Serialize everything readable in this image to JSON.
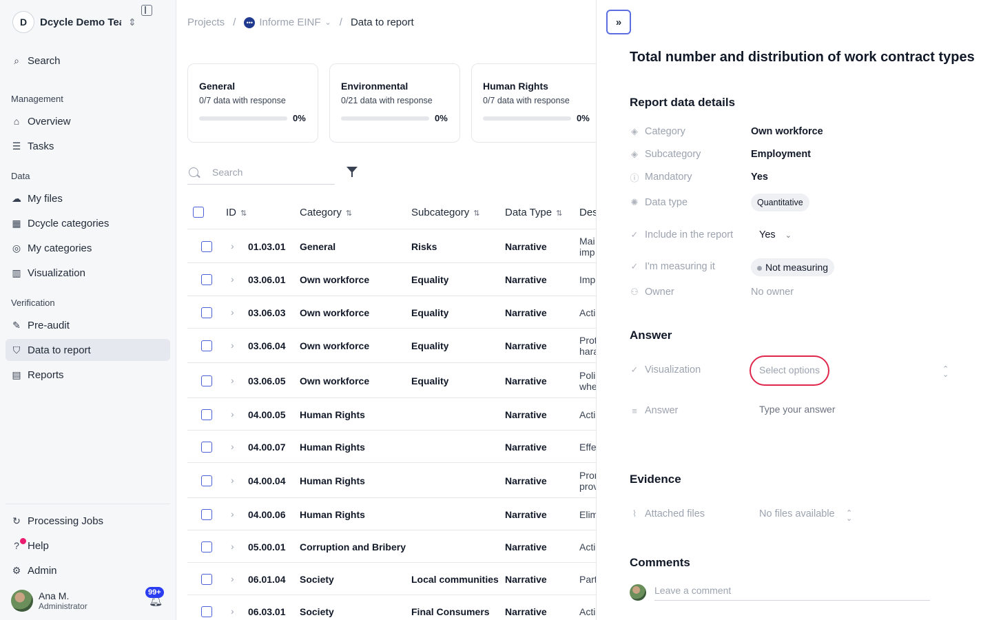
{
  "sidebar": {
    "workspace_initial": "D",
    "workspace_name": "Dcycle Demo Team",
    "search_label": "Search",
    "sections": {
      "management": "Management",
      "data": "Data",
      "verification": "Verification"
    },
    "items": {
      "overview": "Overview",
      "tasks": "Tasks",
      "my_files": "My files",
      "dcycle_categories": "Dcycle categories",
      "my_categories": "My categories",
      "visualization": "Visualization",
      "pre_audit": "Pre-audit",
      "data_to_report": "Data to report",
      "reports": "Reports",
      "processing_jobs": "Processing Jobs",
      "help": "Help",
      "admin": "Admin"
    },
    "user": {
      "name": "Ana M.",
      "role": "Administrator",
      "notifications": "99+"
    }
  },
  "breadcrumb": {
    "projects": "Projects",
    "project": "Informe EINF",
    "current": "Data to report"
  },
  "cards": [
    {
      "title": "General",
      "subtitle": "0/7 data with response",
      "percent": "0%",
      "progress": 0
    },
    {
      "title": "Environmental",
      "subtitle": "0/21 data with response",
      "percent": "0%",
      "progress": 0
    },
    {
      "title": "Human Rights",
      "subtitle": "0/7 data with response",
      "percent": "0%",
      "progress": 0
    }
  ],
  "search": {
    "placeholder": "Search"
  },
  "table": {
    "headers": {
      "id": "ID",
      "category": "Category",
      "subcategory": "Subcategory",
      "data_type": "Data Type",
      "description": "Des"
    },
    "rows": [
      {
        "id": "01.03.01",
        "category": "General",
        "subcategory": "Risks",
        "type": "Narrative",
        "desc1": "Mai",
        "desc2": "imp"
      },
      {
        "id": "03.06.01",
        "category": "Own workforce",
        "subcategory": "Equality",
        "type": "Narrative",
        "desc1": "Imp",
        "desc2": ""
      },
      {
        "id": "03.06.03",
        "category": "Own workforce",
        "subcategory": "Equality",
        "type": "Narrative",
        "desc1": "Acti",
        "desc2": ""
      },
      {
        "id": "03.06.04",
        "category": "Own workforce",
        "subcategory": "Equality",
        "type": "Narrative",
        "desc1": "Prot",
        "desc2": "hara"
      },
      {
        "id": "03.06.05",
        "category": "Own workforce",
        "subcategory": "Equality",
        "type": "Narrative",
        "desc1": "Poli",
        "desc2": "whe"
      },
      {
        "id": "04.00.05",
        "category": "Human Rights",
        "subcategory": "",
        "type": "Narrative",
        "desc1": "Acti",
        "desc2": ""
      },
      {
        "id": "04.00.07",
        "category": "Human Rights",
        "subcategory": "",
        "type": "Narrative",
        "desc1": "Effe",
        "desc2": ""
      },
      {
        "id": "04.00.04",
        "category": "Human Rights",
        "subcategory": "",
        "type": "Narrative",
        "desc1": "Pron",
        "desc2": "prov"
      },
      {
        "id": "04.00.06",
        "category": "Human Rights",
        "subcategory": "",
        "type": "Narrative",
        "desc1": "Elim",
        "desc2": ""
      },
      {
        "id": "05.00.01",
        "category": "Corruption and Bribery",
        "subcategory": "",
        "type": "Narrative",
        "desc1": "Acti",
        "desc2": ""
      },
      {
        "id": "06.01.04",
        "category": "Society",
        "subcategory": "Local communities",
        "type": "Narrative",
        "desc1": "Part",
        "desc2": ""
      },
      {
        "id": "06.03.01",
        "category": "Society",
        "subcategory": "Final Consumers",
        "type": "Narrative",
        "desc1": "Acti",
        "desc2": ""
      }
    ]
  },
  "panel": {
    "title": "Total number and distribution of work contract types",
    "details_heading": "Report data details",
    "labels": {
      "category": "Category",
      "subcategory": "Subcategory",
      "mandatory": "Mandatory",
      "data_type": "Data type",
      "include": "Include in the report",
      "measuring": "I'm measuring it",
      "owner": "Owner",
      "visualization": "Visualization",
      "answer": "Answer",
      "attached": "Attached files"
    },
    "values": {
      "category": "Own workforce",
      "subcategory": "Employment",
      "mandatory": "Yes",
      "data_type": "Quantitative",
      "include": "Yes",
      "measuring": "Not measuring",
      "owner": "No owner",
      "visualization_placeholder": "Select options",
      "answer_placeholder": "Type your answer",
      "attached": "No files available"
    },
    "answer_heading": "Answer",
    "evidence_heading": "Evidence",
    "comments_heading": "Comments",
    "comment_placeholder": "Leave a comment"
  }
}
